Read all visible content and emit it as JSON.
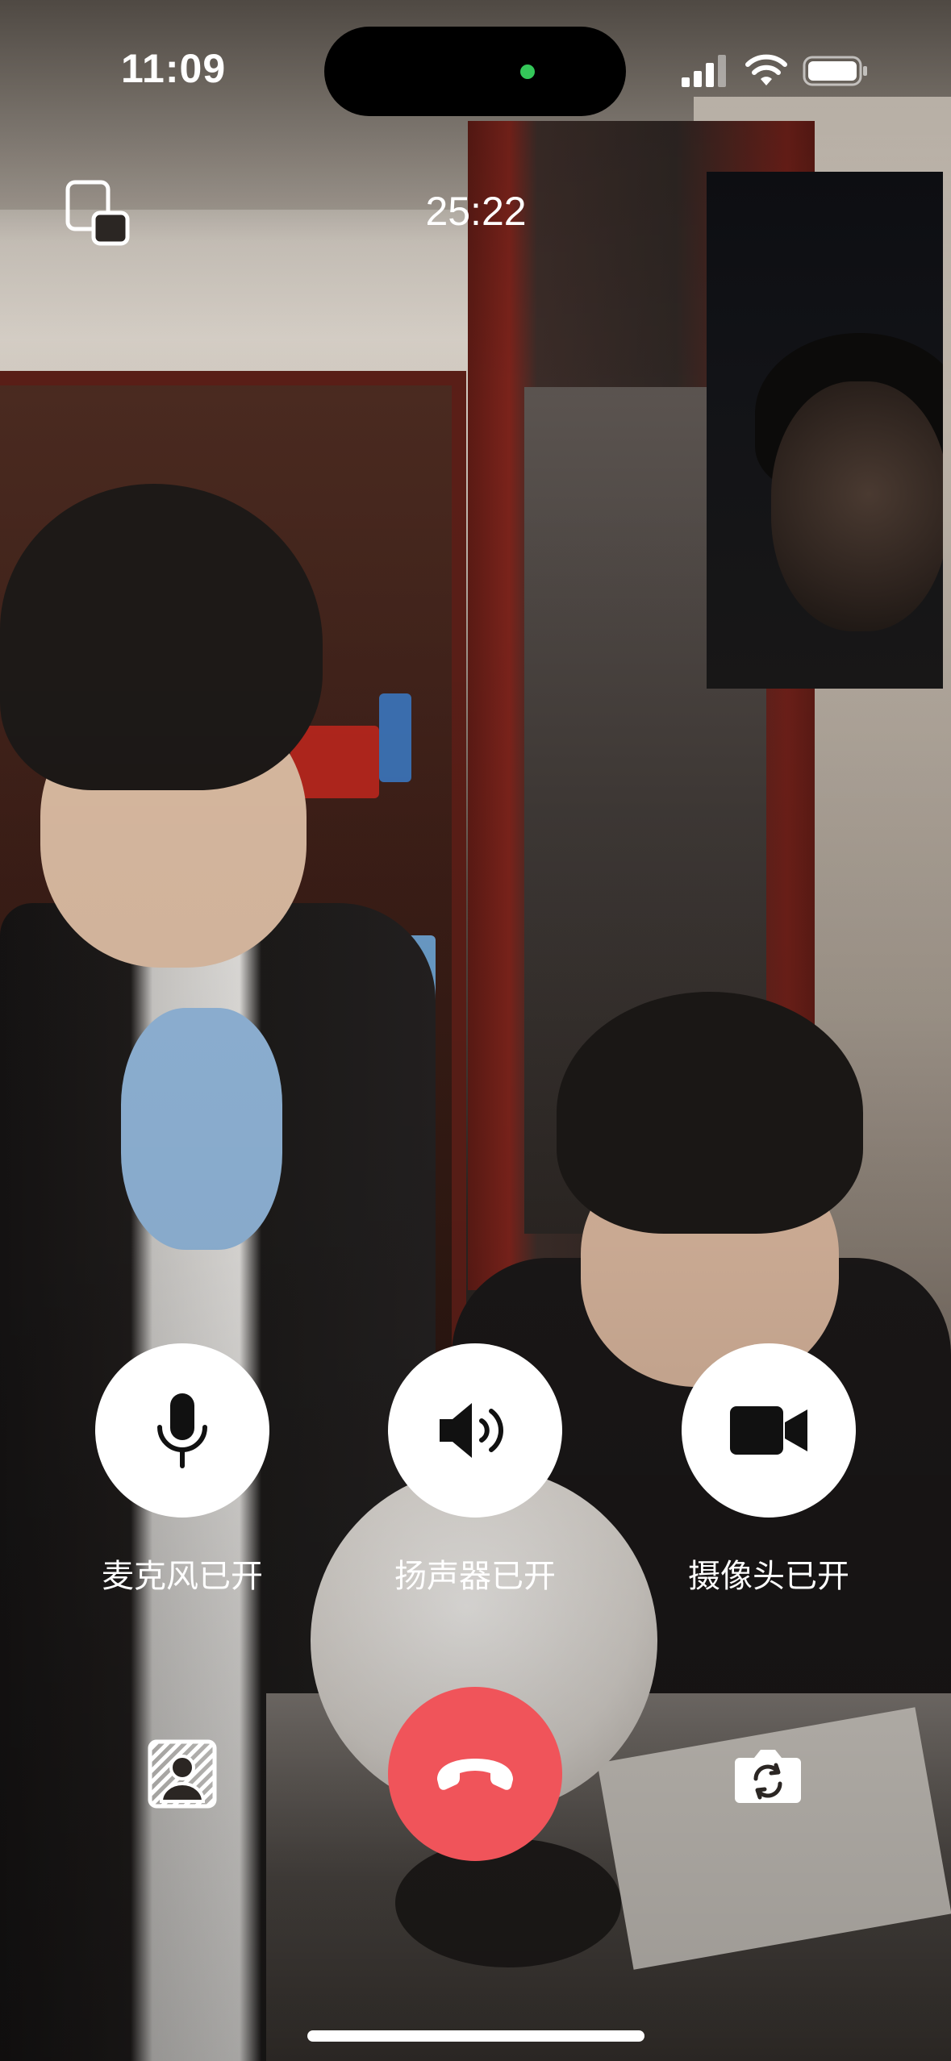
{
  "status_bar": {
    "time": "11:09",
    "icons": [
      "signal-icon",
      "wifi-icon",
      "battery-icon"
    ],
    "camera_indicator_color": "#34c759"
  },
  "call": {
    "timer": "25:22"
  },
  "controls": {
    "microphone": {
      "label": "麦克风已开",
      "icon": "microphone-icon"
    },
    "speaker": {
      "label": "扬声器已开",
      "icon": "speaker-icon"
    },
    "camera": {
      "label": "摄像头已开",
      "icon": "video-camera-icon"
    }
  },
  "bottom_bar": {
    "left_icon": "blur-background-icon",
    "end_call_icon": "hang-up-icon",
    "end_call_color": "#f0545a",
    "right_icon": "switch-camera-icon"
  }
}
